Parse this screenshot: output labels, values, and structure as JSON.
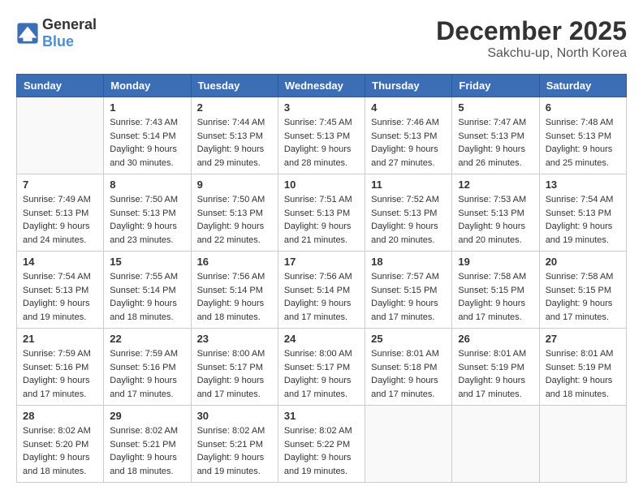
{
  "header": {
    "logo_general": "General",
    "logo_blue": "Blue",
    "month_year": "December 2025",
    "location": "Sakchu-up, North Korea"
  },
  "weekdays": [
    "Sunday",
    "Monday",
    "Tuesday",
    "Wednesday",
    "Thursday",
    "Friday",
    "Saturday"
  ],
  "weeks": [
    [
      {
        "day": "",
        "sunrise": "",
        "sunset": "",
        "daylight": ""
      },
      {
        "day": "1",
        "sunrise": "Sunrise: 7:43 AM",
        "sunset": "Sunset: 5:14 PM",
        "daylight": "Daylight: 9 hours and 30 minutes."
      },
      {
        "day": "2",
        "sunrise": "Sunrise: 7:44 AM",
        "sunset": "Sunset: 5:13 PM",
        "daylight": "Daylight: 9 hours and 29 minutes."
      },
      {
        "day": "3",
        "sunrise": "Sunrise: 7:45 AM",
        "sunset": "Sunset: 5:13 PM",
        "daylight": "Daylight: 9 hours and 28 minutes."
      },
      {
        "day": "4",
        "sunrise": "Sunrise: 7:46 AM",
        "sunset": "Sunset: 5:13 PM",
        "daylight": "Daylight: 9 hours and 27 minutes."
      },
      {
        "day": "5",
        "sunrise": "Sunrise: 7:47 AM",
        "sunset": "Sunset: 5:13 PM",
        "daylight": "Daylight: 9 hours and 26 minutes."
      },
      {
        "day": "6",
        "sunrise": "Sunrise: 7:48 AM",
        "sunset": "Sunset: 5:13 PM",
        "daylight": "Daylight: 9 hours and 25 minutes."
      }
    ],
    [
      {
        "day": "7",
        "sunrise": "Sunrise: 7:49 AM",
        "sunset": "Sunset: 5:13 PM",
        "daylight": "Daylight: 9 hours and 24 minutes."
      },
      {
        "day": "8",
        "sunrise": "Sunrise: 7:50 AM",
        "sunset": "Sunset: 5:13 PM",
        "daylight": "Daylight: 9 hours and 23 minutes."
      },
      {
        "day": "9",
        "sunrise": "Sunrise: 7:50 AM",
        "sunset": "Sunset: 5:13 PM",
        "daylight": "Daylight: 9 hours and 22 minutes."
      },
      {
        "day": "10",
        "sunrise": "Sunrise: 7:51 AM",
        "sunset": "Sunset: 5:13 PM",
        "daylight": "Daylight: 9 hours and 21 minutes."
      },
      {
        "day": "11",
        "sunrise": "Sunrise: 7:52 AM",
        "sunset": "Sunset: 5:13 PM",
        "daylight": "Daylight: 9 hours and 20 minutes."
      },
      {
        "day": "12",
        "sunrise": "Sunrise: 7:53 AM",
        "sunset": "Sunset: 5:13 PM",
        "daylight": "Daylight: 9 hours and 20 minutes."
      },
      {
        "day": "13",
        "sunrise": "Sunrise: 7:54 AM",
        "sunset": "Sunset: 5:13 PM",
        "daylight": "Daylight: 9 hours and 19 minutes."
      }
    ],
    [
      {
        "day": "14",
        "sunrise": "Sunrise: 7:54 AM",
        "sunset": "Sunset: 5:13 PM",
        "daylight": "Daylight: 9 hours and 19 minutes."
      },
      {
        "day": "15",
        "sunrise": "Sunrise: 7:55 AM",
        "sunset": "Sunset: 5:14 PM",
        "daylight": "Daylight: 9 hours and 18 minutes."
      },
      {
        "day": "16",
        "sunrise": "Sunrise: 7:56 AM",
        "sunset": "Sunset: 5:14 PM",
        "daylight": "Daylight: 9 hours and 18 minutes."
      },
      {
        "day": "17",
        "sunrise": "Sunrise: 7:56 AM",
        "sunset": "Sunset: 5:14 PM",
        "daylight": "Daylight: 9 hours and 17 minutes."
      },
      {
        "day": "18",
        "sunrise": "Sunrise: 7:57 AM",
        "sunset": "Sunset: 5:15 PM",
        "daylight": "Daylight: 9 hours and 17 minutes."
      },
      {
        "day": "19",
        "sunrise": "Sunrise: 7:58 AM",
        "sunset": "Sunset: 5:15 PM",
        "daylight": "Daylight: 9 hours and 17 minutes."
      },
      {
        "day": "20",
        "sunrise": "Sunrise: 7:58 AM",
        "sunset": "Sunset: 5:15 PM",
        "daylight": "Daylight: 9 hours and 17 minutes."
      }
    ],
    [
      {
        "day": "21",
        "sunrise": "Sunrise: 7:59 AM",
        "sunset": "Sunset: 5:16 PM",
        "daylight": "Daylight: 9 hours and 17 minutes."
      },
      {
        "day": "22",
        "sunrise": "Sunrise: 7:59 AM",
        "sunset": "Sunset: 5:16 PM",
        "daylight": "Daylight: 9 hours and 17 minutes."
      },
      {
        "day": "23",
        "sunrise": "Sunrise: 8:00 AM",
        "sunset": "Sunset: 5:17 PM",
        "daylight": "Daylight: 9 hours and 17 minutes."
      },
      {
        "day": "24",
        "sunrise": "Sunrise: 8:00 AM",
        "sunset": "Sunset: 5:17 PM",
        "daylight": "Daylight: 9 hours and 17 minutes."
      },
      {
        "day": "25",
        "sunrise": "Sunrise: 8:01 AM",
        "sunset": "Sunset: 5:18 PM",
        "daylight": "Daylight: 9 hours and 17 minutes."
      },
      {
        "day": "26",
        "sunrise": "Sunrise: 8:01 AM",
        "sunset": "Sunset: 5:19 PM",
        "daylight": "Daylight: 9 hours and 17 minutes."
      },
      {
        "day": "27",
        "sunrise": "Sunrise: 8:01 AM",
        "sunset": "Sunset: 5:19 PM",
        "daylight": "Daylight: 9 hours and 18 minutes."
      }
    ],
    [
      {
        "day": "28",
        "sunrise": "Sunrise: 8:02 AM",
        "sunset": "Sunset: 5:20 PM",
        "daylight": "Daylight: 9 hours and 18 minutes."
      },
      {
        "day": "29",
        "sunrise": "Sunrise: 8:02 AM",
        "sunset": "Sunset: 5:21 PM",
        "daylight": "Daylight: 9 hours and 18 minutes."
      },
      {
        "day": "30",
        "sunrise": "Sunrise: 8:02 AM",
        "sunset": "Sunset: 5:21 PM",
        "daylight": "Daylight: 9 hours and 19 minutes."
      },
      {
        "day": "31",
        "sunrise": "Sunrise: 8:02 AM",
        "sunset": "Sunset: 5:22 PM",
        "daylight": "Daylight: 9 hours and 19 minutes."
      },
      {
        "day": "",
        "sunrise": "",
        "sunset": "",
        "daylight": ""
      },
      {
        "day": "",
        "sunrise": "",
        "sunset": "",
        "daylight": ""
      },
      {
        "day": "",
        "sunrise": "",
        "sunset": "",
        "daylight": ""
      }
    ]
  ]
}
